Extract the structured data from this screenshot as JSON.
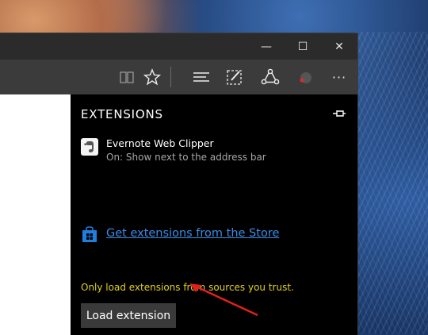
{
  "window": {
    "controls": {
      "minimize_glyph": "—",
      "maximize_glyph": "☐",
      "close_glyph": "✕"
    }
  },
  "toolbar": {
    "icons": [
      "reading-view-icon",
      "favorite-star-icon",
      "hub-icon",
      "web-note-icon",
      "share-icon",
      "extension-icon",
      "more-icon"
    ],
    "more_glyph": "···"
  },
  "hub": {
    "title": "EXTENSIONS",
    "extension": {
      "name": "Evernote Web Clipper",
      "status": "On: Show next to the address bar"
    },
    "store_link": "Get extensions from the Store",
    "warning": "Only load extensions from sources you trust.",
    "load_button": "Load extension"
  },
  "colors": {
    "link": "#3a8ce6",
    "warning": "#e2d21a",
    "annotation_arrow": "#e0201e"
  }
}
